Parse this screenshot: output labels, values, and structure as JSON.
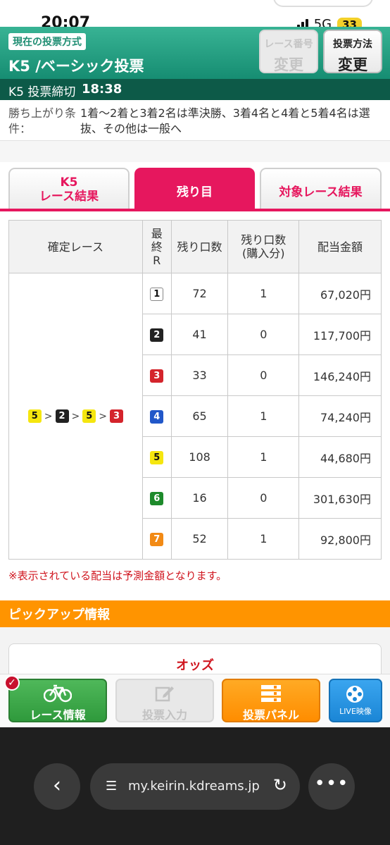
{
  "status": {
    "time": "20:07",
    "network": "5G",
    "battery": "33"
  },
  "header": {
    "method_tag": "現在の投票方式",
    "title": "K5 /ベーシック投票",
    "btn_race_no": {
      "line1": "レース番号",
      "line2": "変更"
    },
    "btn_method": {
      "line1": "投票方法",
      "line2": "変更"
    }
  },
  "deadline": {
    "label": "K5 投票締切",
    "time": "18:38"
  },
  "condition": {
    "label": "勝ち上がり条件：",
    "text": "1着〜2着と3着2名は準決勝、3着4名と4着と5着4名は選抜、その他は一般へ"
  },
  "tabs": [
    {
      "line1": "K5",
      "line2": "レース結果"
    },
    {
      "label": "残り目"
    },
    {
      "label": "対象レース結果"
    }
  ],
  "table": {
    "headers": {
      "race": "確定レース",
      "final_r": [
        "最",
        "終",
        "R"
      ],
      "remaining": "残り口数",
      "bought": [
        "残り口数",
        "(購入分)"
      ],
      "payout": "配当金額"
    },
    "confirmed_sequence": [
      {
        "num": "5",
        "sep": ">"
      },
      {
        "num": "2",
        "sep": ">"
      },
      {
        "num": "5",
        "sep": ">"
      },
      {
        "num": "3",
        "sep": ""
      }
    ],
    "rows": [
      {
        "num": "1",
        "remaining": "72",
        "bought": "1",
        "payout": "67,020円"
      },
      {
        "num": "2",
        "remaining": "41",
        "bought": "0",
        "payout": "117,700円"
      },
      {
        "num": "3",
        "remaining": "33",
        "bought": "0",
        "payout": "146,240円"
      },
      {
        "num": "4",
        "remaining": "65",
        "bought": "1",
        "payout": "74,240円"
      },
      {
        "num": "5",
        "remaining": "108",
        "bought": "1",
        "payout": "44,680円"
      },
      {
        "num": "6",
        "remaining": "16",
        "bought": "0",
        "payout": "301,630円"
      },
      {
        "num": "7",
        "remaining": "52",
        "bought": "1",
        "payout": "92,800円"
      }
    ]
  },
  "note": "※表示されている配当は予測金額となります。",
  "pickup": {
    "title": "ピックアップ情報",
    "odds": "オッズ"
  },
  "appbar": {
    "race_info": "レース情報",
    "vote_input": "投票入力",
    "vote_panel": "投票パネル",
    "live": "LIVE映像"
  },
  "browser": {
    "url": "my.keirin.kdreams.jp"
  }
}
